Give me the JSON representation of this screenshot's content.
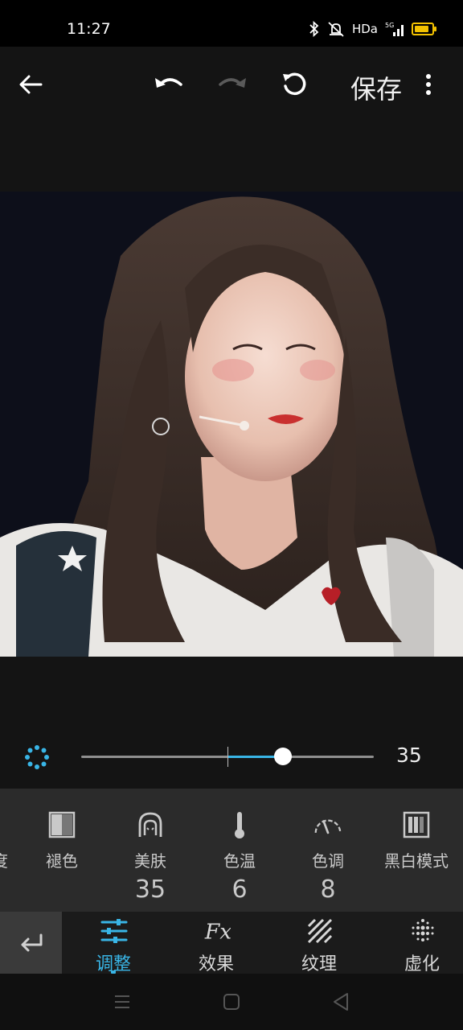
{
  "status": {
    "time": "11:27",
    "network_label": "HDa",
    "signal_label": "5G"
  },
  "toolbar": {
    "save_label": "保存"
  },
  "slider": {
    "value": "35",
    "value_fraction": 0.69,
    "center_fraction": 0.5
  },
  "tools": [
    {
      "label": "褪色",
      "icon": "fade-icon",
      "value": ""
    },
    {
      "label": "美肤",
      "icon": "skin-icon",
      "value": "35"
    },
    {
      "label": "色温",
      "icon": "thermometer-icon",
      "value": "6"
    },
    {
      "label": "色调",
      "icon": "tone-gauge-icon",
      "value": "8"
    },
    {
      "label": "黑白模式",
      "icon": "bw-mode-icon",
      "value": ""
    }
  ],
  "tools_partial_label": "度",
  "nav": {
    "tabs": [
      {
        "label": "调整",
        "icon": "adjust-sliders-icon",
        "active": true
      },
      {
        "label": "效果",
        "icon": "fx-icon",
        "active": false
      },
      {
        "label": "纹理",
        "icon": "texture-icon",
        "active": false
      },
      {
        "label": "虚化",
        "icon": "blur-dots-icon",
        "active": false
      }
    ]
  },
  "colors": {
    "accent": "#39b5e6",
    "battery": "#f3c200",
    "panel": "#2b2b2b",
    "background": "#141414"
  }
}
